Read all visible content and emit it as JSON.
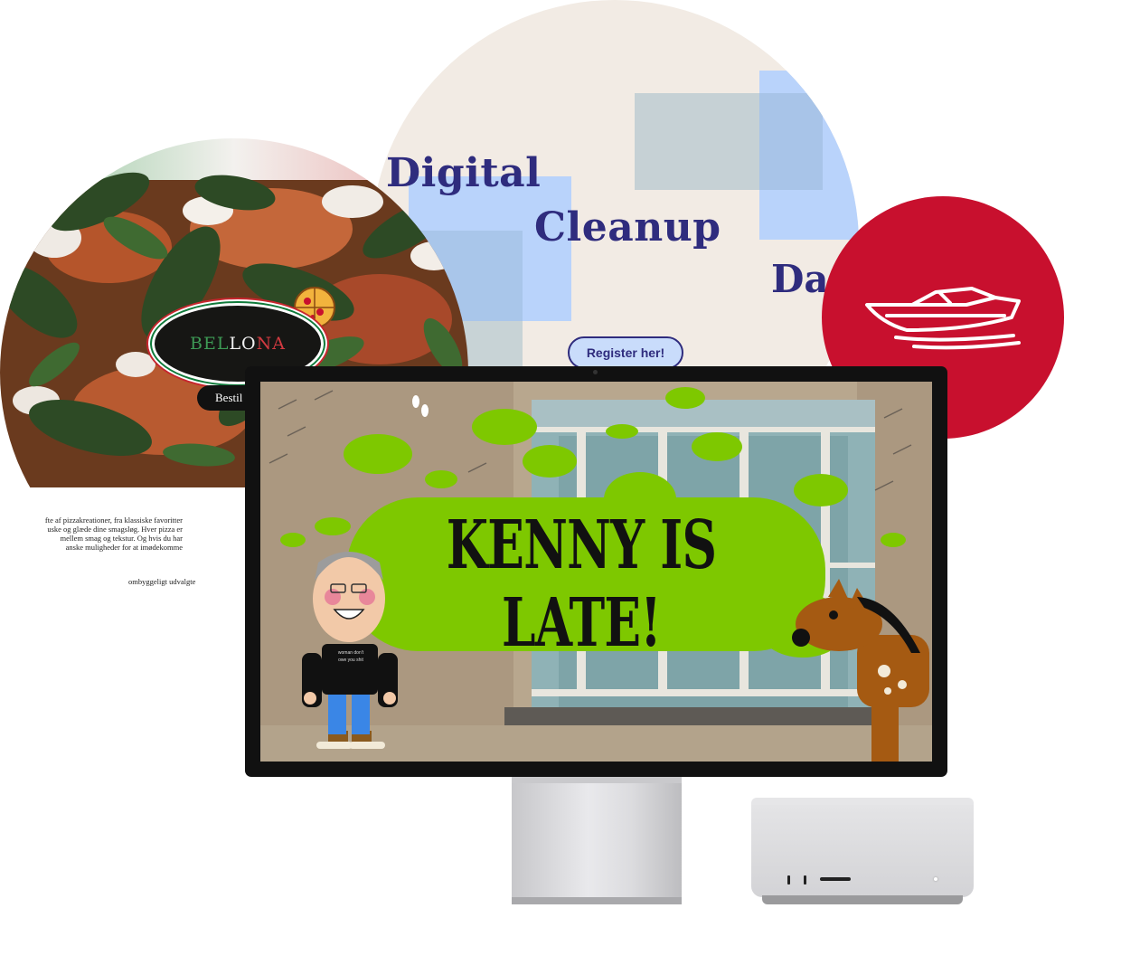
{
  "cleanup_site": {
    "title_word_1": "Digital",
    "title_word_2": "Cleanup",
    "register_button": "Register her!",
    "partial_word": "Da"
  },
  "bellona_site": {
    "logo_text_1": "BEL",
    "logo_text_2": "LO",
    "logo_text_3": "NA",
    "order_button": "Bestil n",
    "text_line_1": "fte af pizzakreationer, fra klassiske favoritter",
    "text_line_2": "uske og glæde dine smagsløg. Hver pizza er",
    "text_line_3": "mellem smag og tekstur. Og hvis du har",
    "text_line_4": "anske muligheder for at imødekomme",
    "text_line_5": "ombyggeligt udvalgte"
  },
  "monitor_screen": {
    "title": "KENNY IS LATE!",
    "shirt_text_1": "woman don't",
    "shirt_text_2": "owe you shit"
  },
  "colors": {
    "cleanup_bg": "#f2ebe4",
    "cleanup_text": "#2f2c7e",
    "boat_red": "#c8102e",
    "slime_green": "#7ec800"
  },
  "icons": [
    "pizza-icon",
    "boat-icon"
  ]
}
